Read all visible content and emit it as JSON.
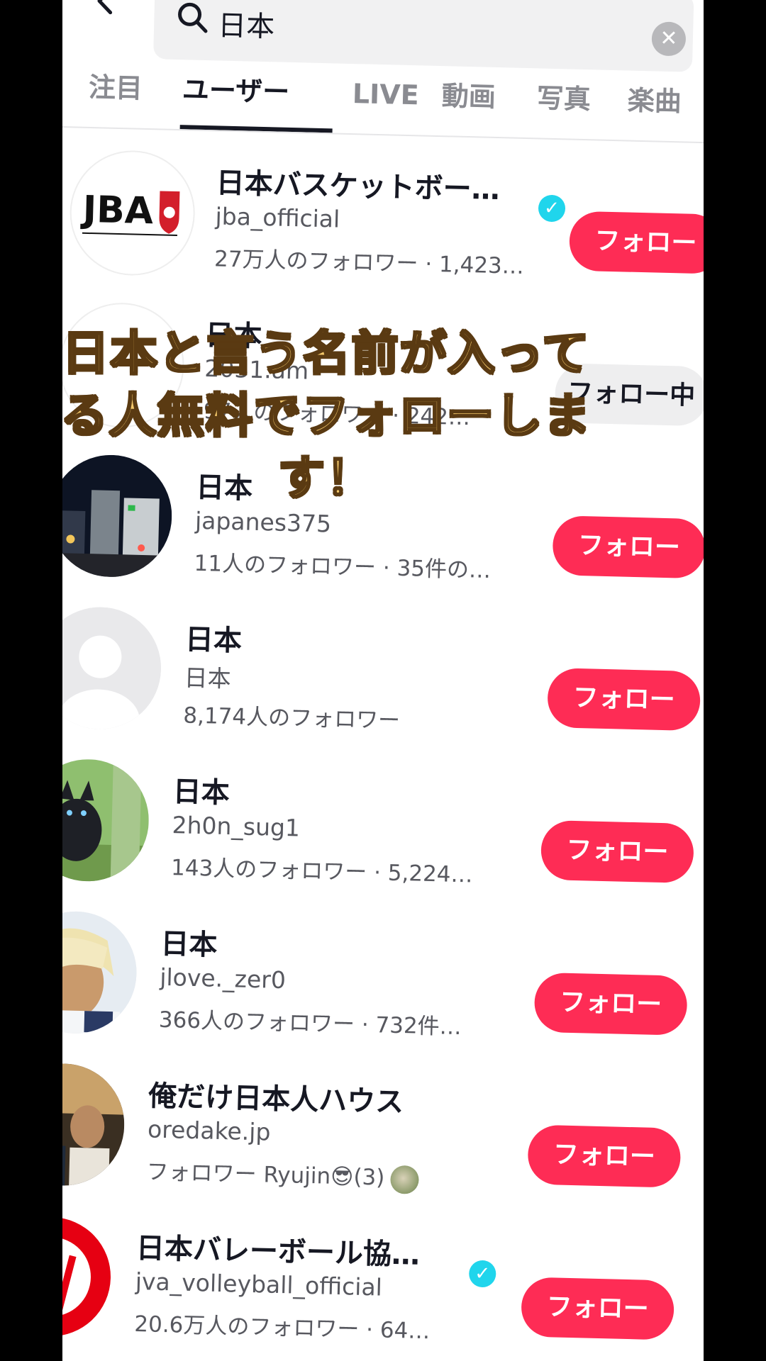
{
  "search": {
    "query": "日本",
    "clear_icon": "close-icon"
  },
  "tabs": [
    {
      "label": "注目"
    },
    {
      "label": "ユーザー",
      "active": true
    },
    {
      "label": "LIVE"
    },
    {
      "label": "動画"
    },
    {
      "label": "写真"
    },
    {
      "label": "楽曲"
    }
  ],
  "users": [
    {
      "name": "日本バスケットボー…",
      "verified": true,
      "handle": "jba_official",
      "meta": "27万人のフォロワー · 1,423…",
      "follow_label": "フォロー",
      "avatar_text": "JBA"
    },
    {
      "name": "日本",
      "verified": false,
      "handle": "2031.am",
      "meta": "97人のフォロワー · 242…",
      "follow_label": "フォロー中"
    },
    {
      "name": "日本",
      "verified": false,
      "handle": "japanes375",
      "meta": "11人のフォロワー · 35件の…",
      "follow_label": "フォロー"
    },
    {
      "name": "日本",
      "verified": false,
      "handle": "日本",
      "meta": "8,174人のフォロワー",
      "follow_label": "フォロー"
    },
    {
      "name": "日本",
      "verified": false,
      "handle": "2h0n_sug1",
      "meta": "143人のフォロワー · 5,224…",
      "follow_label": "フォロー"
    },
    {
      "name": "日本",
      "verified": false,
      "handle": "jlove._zer0",
      "meta": "366人のフォロワー · 732件…",
      "follow_label": "フォロー"
    },
    {
      "name": "俺だけ日本人ハウス",
      "verified": false,
      "handle": "oredake.jp",
      "meta": "フォロワー Ryujin😎(3)",
      "follow_label": "フォロー"
    },
    {
      "name": "日本バレーボール協…",
      "verified": true,
      "handle": "jva_volleyball_official",
      "meta": "20.6万人のフォロワー · 64…",
      "follow_label": "フォロー"
    }
  ],
  "caption": {
    "line1": "日本と言う名前が入って",
    "line2": "る人無料でフォローしま",
    "line3": "す！"
  }
}
